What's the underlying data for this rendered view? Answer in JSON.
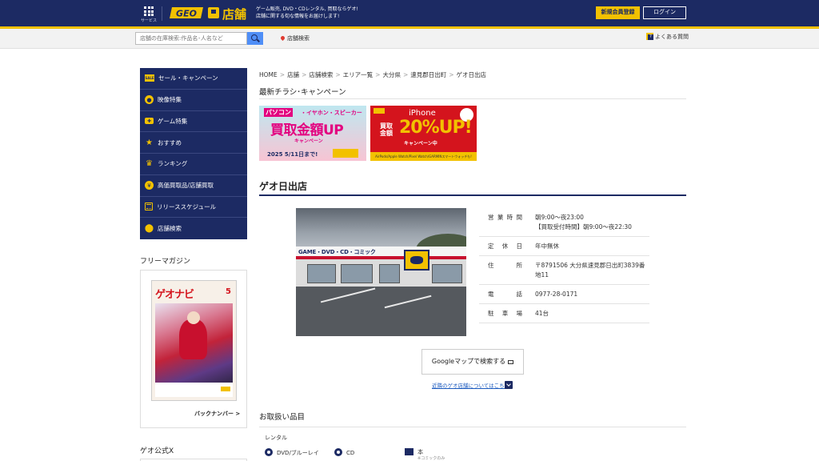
{
  "header": {
    "service_label": "サービス",
    "logo_text": "GEO",
    "section_label": "店舗",
    "tagline_1": "ゲーム販売, DVD・CDレンタル, 買取ならゲオ!",
    "tagline_2": "店舗に関する旬な情報をお届けします!",
    "register_label": "新規会員登録",
    "login_label": "ログイン",
    "colors": {
      "navy": "#1c2a63",
      "yellow": "#f2c100"
    }
  },
  "searchbar": {
    "placeholder": "店舗の在庫検索:作品名･人名など",
    "store_search_label": "店舗検索",
    "faq_label": "よくある質問"
  },
  "sidebar": {
    "items": [
      {
        "label": "セール・キャンペーン",
        "icon": "sale-icon"
      },
      {
        "label": "映像特集",
        "icon": "disc-icon"
      },
      {
        "label": "ゲーム特集",
        "icon": "gamepad-icon"
      },
      {
        "label": "おすすめ",
        "icon": "star-icon"
      },
      {
        "label": "ランキング",
        "icon": "crown-icon"
      },
      {
        "label": "高価買取品/店舗買取",
        "icon": "buyback-icon"
      },
      {
        "label": "リリーススケジュール",
        "icon": "calendar-icon"
      },
      {
        "label": "店舗検索",
        "icon": "pin-icon"
      }
    ],
    "magazine_title": "フリーマガジン",
    "magazine_cover_title": "ゲオナビ",
    "magazine_issue": "5",
    "back_number_label": "バックナンバー >",
    "x_title": "ゲオ公式X"
  },
  "breadcrumb": [
    "HOME",
    "店舗",
    "店舗検索",
    "エリア一覧",
    "大分県",
    "速見郡日出町",
    "ゲオ日出店"
  ],
  "flyers": {
    "title": "最新チラシ･キャンペーン",
    "banner1": {
      "tag": "パソコン",
      "subtitle": "・イヤホン・スピーカー",
      "headline": "買取金額UP",
      "campaign": "キャンペーン",
      "date": "2025 5/11日まで!"
    },
    "banner2": {
      "product": "iPhone",
      "buy_label": "買取金額",
      "percent": "20%UP!",
      "campaign": "キャンペーン中",
      "footer": "AirPods/Apple Watch/Pixel Watch/GARMINスマートウォッチも!"
    }
  },
  "store": {
    "name": "ゲオ日出店",
    "photo_sign_text": "GAME・DVD・CD・コミック",
    "info": [
      {
        "key": "営業時間",
        "value": "朝9:00～夜23:00\n【買取受付時間】朝9:00～夜22:30"
      },
      {
        "key": "定休日",
        "value": "年中無休"
      },
      {
        "key": "住所",
        "value": "〒8791506 大分県速見郡日出町3839番地11"
      },
      {
        "key": "電話",
        "value": "0977-28-0171"
      },
      {
        "key": "駐車場",
        "value": "41台"
      }
    ],
    "google_map_label": "Googleマップで検索する",
    "nearby_label": "近隣のゲオ店舗についてはこちら"
  },
  "goods": {
    "title": "お取扱い品目",
    "rental_label": "レンタル",
    "items": [
      {
        "label": "DVD/ブルーレイ",
        "icon": "disc-icon"
      },
      {
        "label": "CD",
        "icon": "cd-icon"
      },
      {
        "label": "本",
        "sub": "※コミックのみ",
        "icon": "book-icon"
      }
    ]
  }
}
